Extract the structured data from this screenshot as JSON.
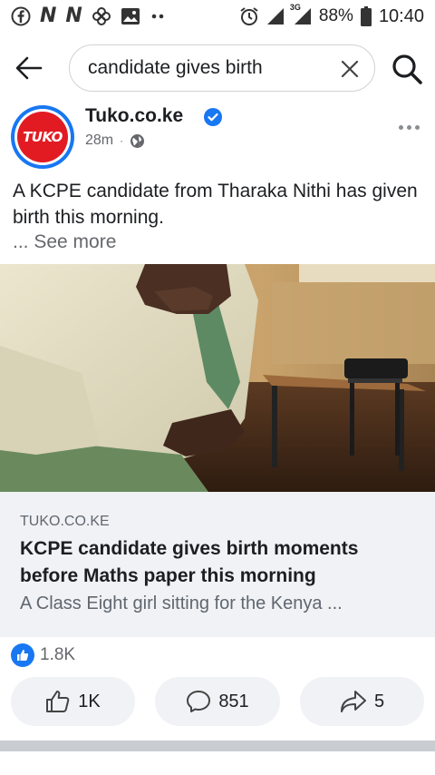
{
  "status_bar": {
    "left_icons": [
      "facebook-icon",
      "n-logo-icon",
      "n-logo-icon",
      "pinwheel-icon",
      "gallery-icon",
      "more-dots-icon"
    ],
    "n_glyph": "N",
    "network_label": "3G",
    "battery_percent": "88%",
    "time": "10:40"
  },
  "search": {
    "query": "candidate gives birth",
    "back_icon": "back-arrow-icon",
    "clear_icon": "close-icon",
    "search_icon": "search-icon"
  },
  "post": {
    "page_name": "Tuko.co.ke",
    "avatar_text": "TUKO",
    "verified": true,
    "time_ago": "28m",
    "meta_separator": "·",
    "audience_icon": "globe-icon",
    "text": "A KCPE candidate from Tharaka Nithi has given birth this morning.",
    "see_more": "... See more"
  },
  "link_preview": {
    "domain": "TUKO.CO.KE",
    "title": "KCPE candidate gives birth moments before Maths paper this morning",
    "description": "A Class Eight girl sitting for the Kenya ..."
  },
  "reactions": {
    "count": "1.8K"
  },
  "actions": [
    {
      "label": "1K",
      "icon": "like-icon"
    },
    {
      "label": "851",
      "icon": "comment-icon"
    },
    {
      "label": "5",
      "icon": "share-icon"
    }
  ],
  "colors": {
    "brand_blue": "#1877f2",
    "tuko_red": "#e21b23",
    "secondary_text": "#65676b",
    "card_bg": "#f0f2f5"
  }
}
